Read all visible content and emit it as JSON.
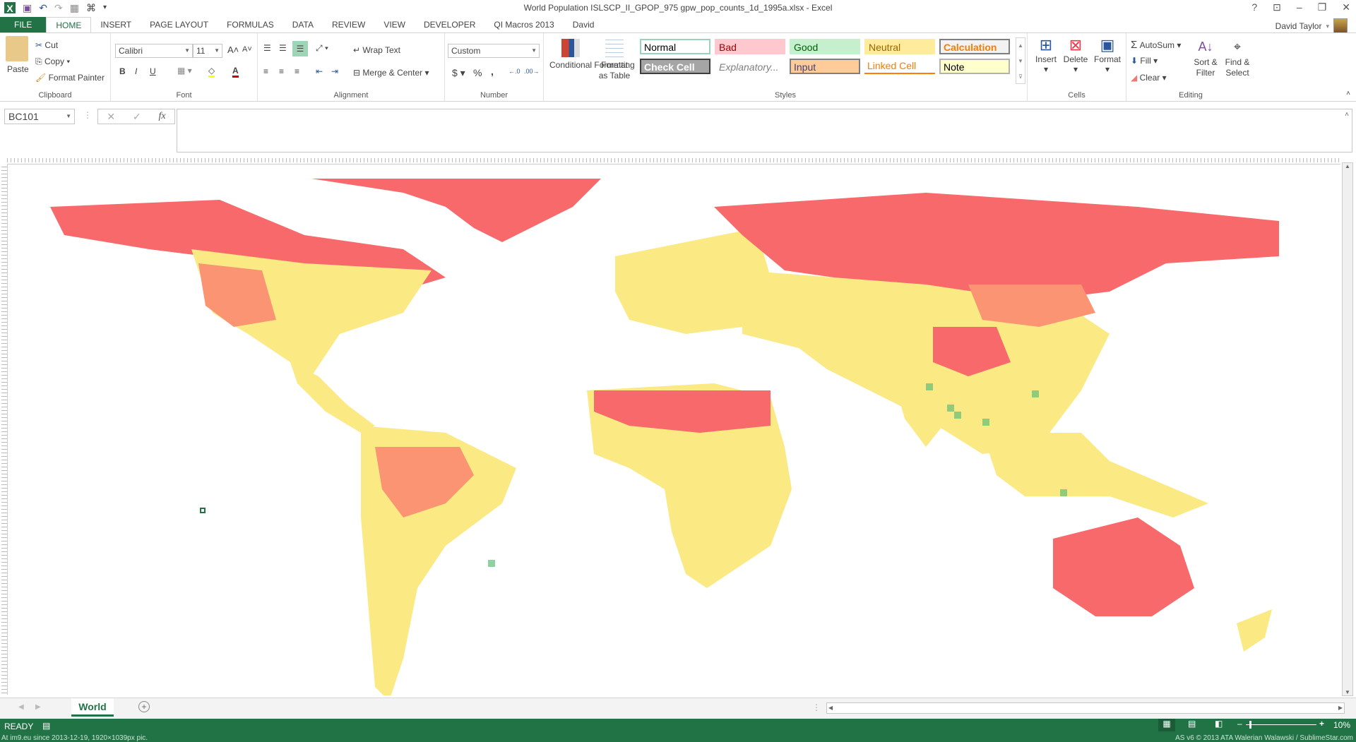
{
  "window": {
    "title": "World Population ISLSCP_II_GPOP_975 gpw_pop_counts_1d_1995a.xlsx - Excel",
    "controls": [
      "?",
      "ribbon-display",
      "minimize",
      "restore",
      "close"
    ]
  },
  "user": {
    "name": "David Taylor"
  },
  "tabs": [
    "FILE",
    "HOME",
    "INSERT",
    "PAGE LAYOUT",
    "FORMULAS",
    "DATA",
    "REVIEW",
    "VIEW",
    "DEVELOPER",
    "QI Macros 2013",
    "David"
  ],
  "active_tab": "HOME",
  "clipboard": {
    "paste": "Paste",
    "cut": "Cut",
    "copy": "Copy",
    "format_painter": "Format Painter",
    "label": "Clipboard"
  },
  "font": {
    "name": "Calibri",
    "size": "11",
    "bold": "B",
    "italic": "I",
    "underline": "U",
    "label": "Font"
  },
  "alignment": {
    "wrap_text": "Wrap Text",
    "merge_center": "Merge & Center",
    "label": "Alignment"
  },
  "number": {
    "format": "Custom",
    "currency": "$",
    "percent": "%",
    "comma": ",",
    "label": "Number"
  },
  "styles": {
    "conditional": "Conditional Formatting",
    "format_table": "Format as Table",
    "label": "Styles",
    "cells": [
      {
        "name": "Normal",
        "bg": "#ffffff",
        "fg": "#000000",
        "border": "#9ad3bc"
      },
      {
        "name": "Bad",
        "bg": "#ffc7ce",
        "fg": "#9c0006",
        "border": "#ffc7ce"
      },
      {
        "name": "Good",
        "bg": "#c6efce",
        "fg": "#006100",
        "border": "#c6efce"
      },
      {
        "name": "Neutral",
        "bg": "#ffeb9c",
        "fg": "#9c6500",
        "border": "#ffeb9c"
      },
      {
        "name": "Calculation",
        "bg": "#f2f2f2",
        "fg": "#fa7d00",
        "border": "#7f7f7f"
      },
      {
        "name": "Check Cell",
        "bg": "#a5a5a5",
        "fg": "#ffffff",
        "border": "#3f3f3f"
      },
      {
        "name": "Explanatory...",
        "bg": "#ffffff",
        "fg": "#7f7f7f",
        "border": "#ffffff"
      },
      {
        "name": "Input",
        "bg": "#ffcc99",
        "fg": "#3f3f76",
        "border": "#7f7f7f"
      },
      {
        "name": "Linked Cell",
        "bg": "#ffffff",
        "fg": "#fa7d00",
        "border": "#ff8001"
      },
      {
        "name": "Note",
        "bg": "#ffffcc",
        "fg": "#000000",
        "border": "#b2b2b2"
      }
    ]
  },
  "cells": {
    "insert": "Insert",
    "delete": "Delete",
    "format": "Format",
    "label": "Cells"
  },
  "editing": {
    "autosum": "AutoSum",
    "fill": "Fill",
    "clear": "Clear",
    "sort_filter": "Sort & Filter",
    "find_select": "Find & Select",
    "label": "Editing"
  },
  "formula_bar": {
    "name_box": "BC101",
    "fx": "fx",
    "value": ""
  },
  "map_colors": {
    "low": "#f8696b",
    "mid": "#fbe983",
    "high": "#63be7b",
    "midlow": "#fa9473"
  },
  "sheet_tabs": [
    "World"
  ],
  "status": {
    "ready": "READY",
    "zoom": "10%",
    "watermark_left": "At im9.eu  since 2013-12-19, 1920×1039px pic.",
    "watermark_right": "AS v6 © 2013 ATA Walerian Walawski / SublimeStar.com"
  }
}
